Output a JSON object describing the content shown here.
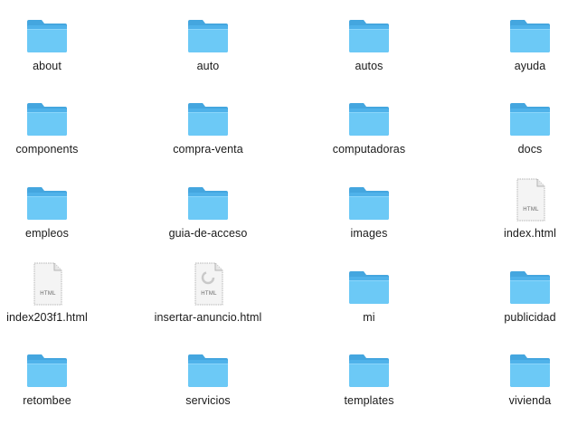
{
  "window": {
    "view": "icon-grid"
  },
  "colors": {
    "folder_back": "#4fb2ea",
    "folder_front": "#6cc9f6",
    "folder_tab": "#44a6df",
    "doc_paper": "#f4f4f4",
    "doc_border": "#b5b5b5",
    "text": "#1a1a1a"
  },
  "items": [
    {
      "name": "about",
      "kind": "folder"
    },
    {
      "name": "auto",
      "kind": "folder"
    },
    {
      "name": "autos",
      "kind": "folder"
    },
    {
      "name": "ayuda",
      "kind": "folder"
    },
    {
      "name": "components",
      "kind": "folder"
    },
    {
      "name": "compra-venta",
      "kind": "folder"
    },
    {
      "name": "computadoras",
      "kind": "folder"
    },
    {
      "name": "docs",
      "kind": "folder"
    },
    {
      "name": "empleos",
      "kind": "folder"
    },
    {
      "name": "guia-de-acceso",
      "kind": "folder"
    },
    {
      "name": "images",
      "kind": "folder"
    },
    {
      "name": "index.html",
      "kind": "html",
      "badge": "HTML"
    },
    {
      "name": "index203f1.html",
      "kind": "html",
      "badge": "HTML"
    },
    {
      "name": "insertar-anuncio.html",
      "kind": "html-loading",
      "badge": "HTML"
    },
    {
      "name": "mi",
      "kind": "folder"
    },
    {
      "name": "publicidad",
      "kind": "folder"
    },
    {
      "name": "retombee",
      "kind": "folder"
    },
    {
      "name": "servicios",
      "kind": "folder"
    },
    {
      "name": "templates",
      "kind": "folder"
    },
    {
      "name": "vivienda",
      "kind": "folder"
    }
  ]
}
